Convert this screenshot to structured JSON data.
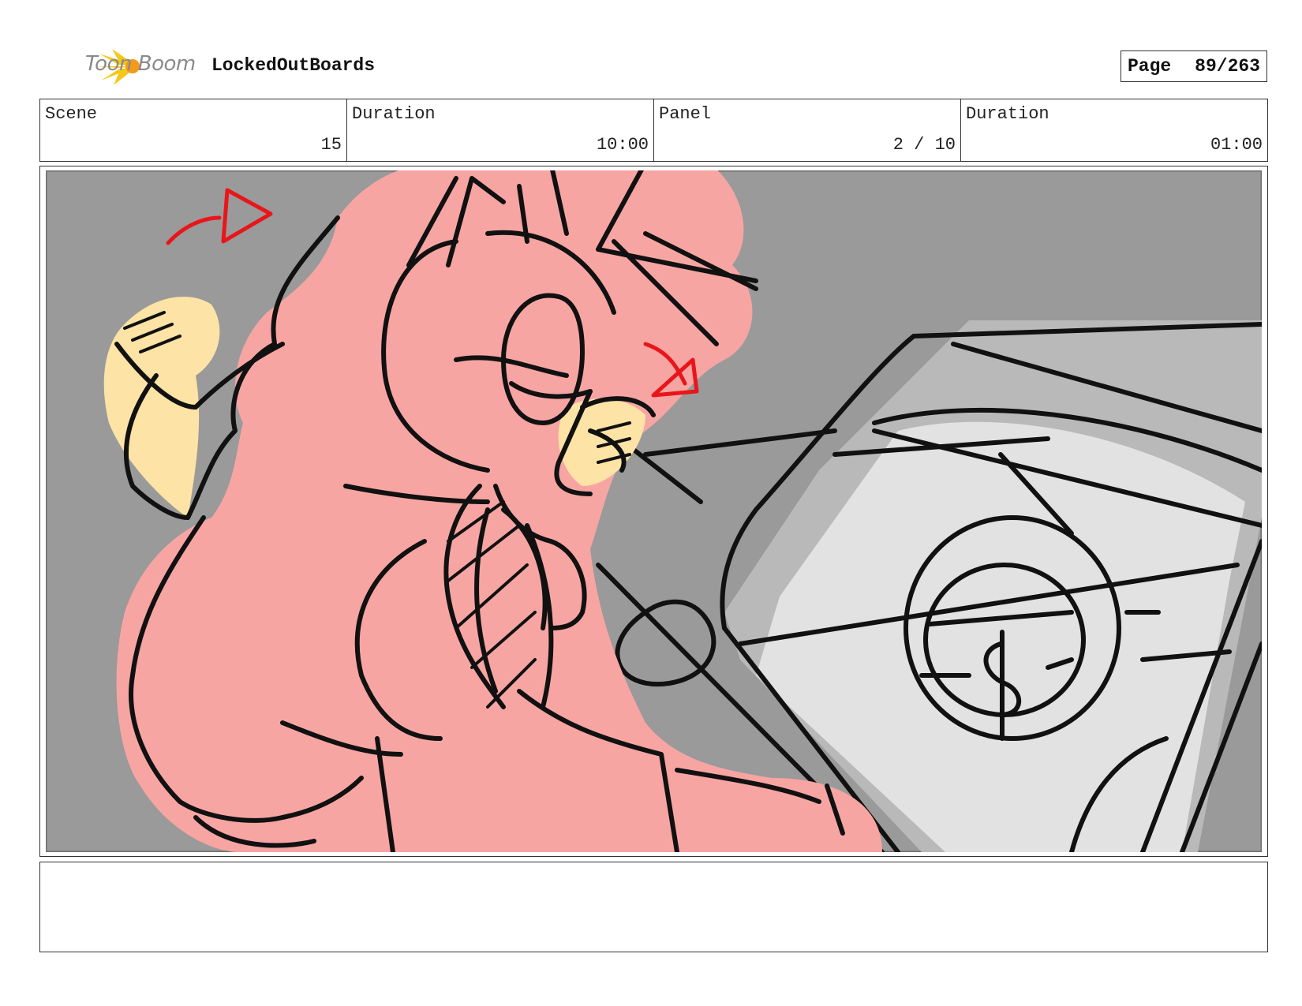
{
  "header": {
    "brand": "Toon Boom",
    "project_name": "LockedOutBoards",
    "page_label": "Page",
    "page_value": "89/263"
  },
  "info": {
    "scene_label": "Scene",
    "scene_value": "15",
    "scene_duration_label": "Duration",
    "scene_duration_value": "10:00",
    "panel_label": "Panel",
    "panel_value": "2 / 10",
    "panel_duration_label": "Duration",
    "panel_duration_value": "01:00"
  },
  "notes": {
    "text": ""
  },
  "colors": {
    "background": "#9a9a9a",
    "character": "#f7a5a3",
    "skin": "#fde3a5",
    "device": "#e2e2e2",
    "markup_red": "#e8161a",
    "logo_yellow": "#f6c81b"
  }
}
